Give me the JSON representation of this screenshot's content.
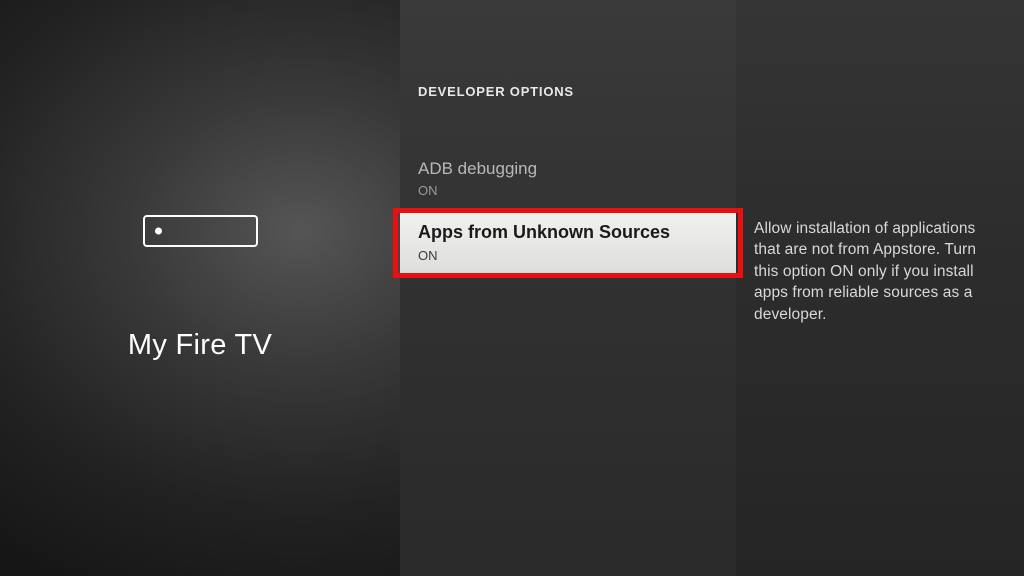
{
  "left": {
    "title": "My Fire TV"
  },
  "middle": {
    "header": "DEVELOPER OPTIONS",
    "options": [
      {
        "title": "ADB debugging",
        "status": "ON"
      },
      {
        "title": "Apps from Unknown Sources",
        "status": "ON"
      }
    ]
  },
  "right": {
    "description": "Allow installation of applications that are not from Appstore. Turn this option ON only if you install apps from reliable sources as a developer."
  }
}
